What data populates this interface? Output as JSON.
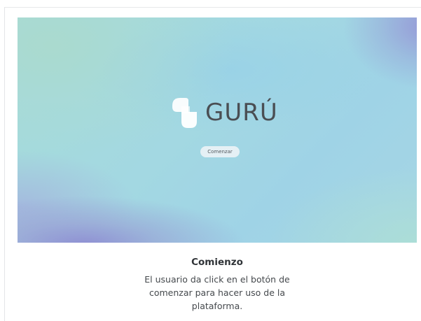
{
  "hero": {
    "brand_name": "GURÚ",
    "logo_icon": "guru-logo-icon",
    "start_button_label": "Comenzar",
    "colors": {
      "teal": "#a6dcd7",
      "sky": "#9fd3e6",
      "lavender": "#8e8cd2",
      "brand_text": "#4a4e53"
    }
  },
  "caption": {
    "title": "Comienzo",
    "description": "El usuario da click en el botón de comenzar para hacer uso de la plataforma."
  }
}
